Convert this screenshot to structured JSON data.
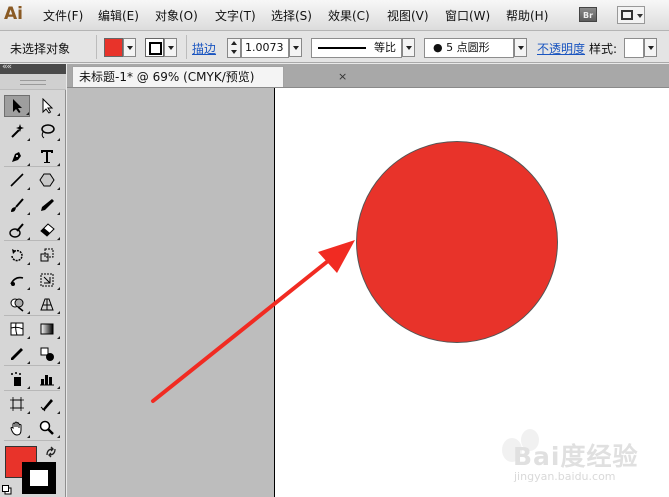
{
  "app": {
    "logo": "Ai"
  },
  "menu": {
    "items": [
      "文件(F)",
      "编辑(E)",
      "对象(O)",
      "文字(T)",
      "选择(S)",
      "效果(C)",
      "视图(V)",
      "窗口(W)",
      "帮助(H)"
    ],
    "bridge_label": "Br"
  },
  "control_bar": {
    "selection_status": "未选择对象",
    "fill_color": "#e8332a",
    "stroke_label": "描边",
    "stroke_weight": "1.0073",
    "stroke_profile": "等比",
    "brush": "5 点圆形",
    "opacity_label": "不透明度",
    "style_label": "样式"
  },
  "document": {
    "tab_title": "未标题-1* @ 69% (CMYK/预览)",
    "close_symbol": "×"
  },
  "canvas": {
    "circle_color": "#e8332a",
    "arrow_color": "#f12b22"
  },
  "tools": [
    "selection-tool",
    "direct-selection-tool",
    "magic-wand-tool",
    "lasso-tool",
    "pen-tool",
    "type-tool",
    "line-segment-tool",
    "polygon-tool",
    "paintbrush-tool",
    "pencil-tool",
    "blob-brush-tool",
    "eraser-tool",
    "rotate-tool",
    "scale-tool",
    "warp-tool",
    "free-transform-tool",
    "shape-builder-tool",
    "perspective-grid-tool",
    "mesh-tool",
    "gradient-tool",
    "eyedropper-tool",
    "blend-tool",
    "symbol-sprayer-tool",
    "column-graph-tool",
    "artboard-tool",
    "slice-tool",
    "hand-tool",
    "zoom-tool"
  ],
  "watermark": {
    "text": "Bai度经验",
    "url": "jingyan.baidu.com"
  }
}
